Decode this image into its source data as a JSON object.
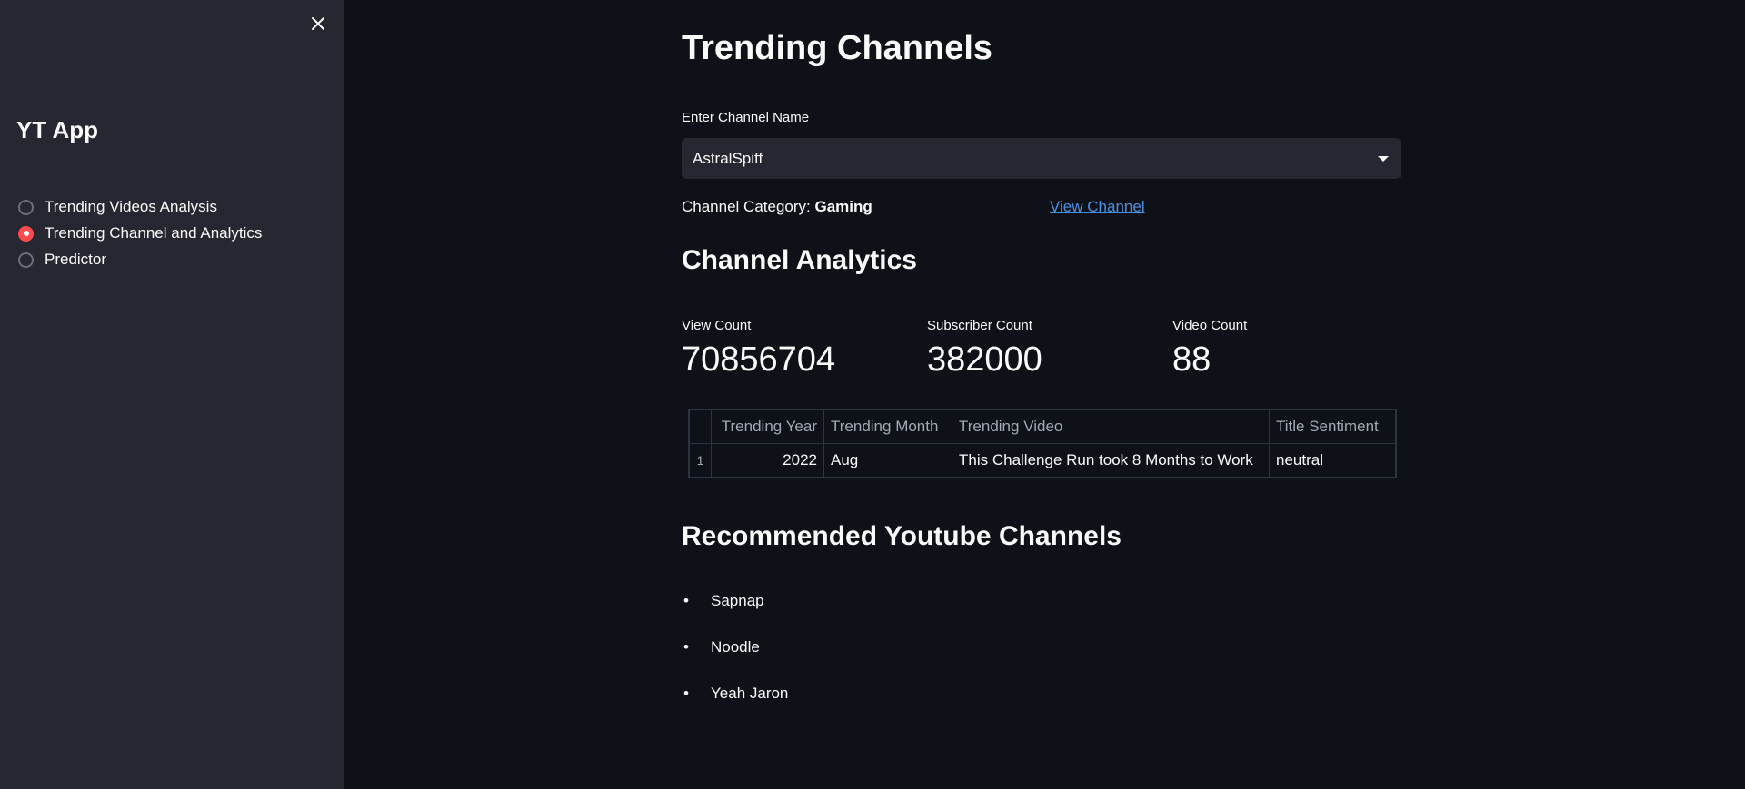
{
  "sidebar": {
    "title": "YT App",
    "options": [
      {
        "label": "Trending Videos Analysis",
        "selected": false
      },
      {
        "label": "Trending Channel and Analytics",
        "selected": true
      },
      {
        "label": "Predictor",
        "selected": false
      }
    ],
    "close_icon": "close-icon"
  },
  "main": {
    "title": "Trending Channels",
    "select_label": "Enter Channel Name",
    "select_value": "AstralSpiff",
    "category_label": "Channel Category:",
    "category_value": "Gaming",
    "view_channel_link": "View Channel",
    "analytics_title": "Channel Analytics",
    "metrics": [
      {
        "label": "View Count",
        "value": "70856704"
      },
      {
        "label": "Subscriber Count",
        "value": "382000"
      },
      {
        "label": "Video Count",
        "value": "88"
      }
    ],
    "table": {
      "headers": [
        "",
        "Trending Year",
        "Trending Month",
        "Trending Video",
        "Title Sentiment"
      ],
      "rows": [
        {
          "index": "1",
          "year": "2022",
          "month": "Aug",
          "video": "This Challenge Run took 8 Months to Work",
          "sentiment": "neutral"
        }
      ]
    },
    "recommended_title": "Recommended Youtube Channels",
    "recommended": [
      "Sapnap",
      "Noodle",
      "Yeah Jaron"
    ]
  },
  "colors": {
    "background": "#0e1117",
    "sidebar": "#262730",
    "accent": "#ff4b4b",
    "link": "#4a90e2"
  }
}
